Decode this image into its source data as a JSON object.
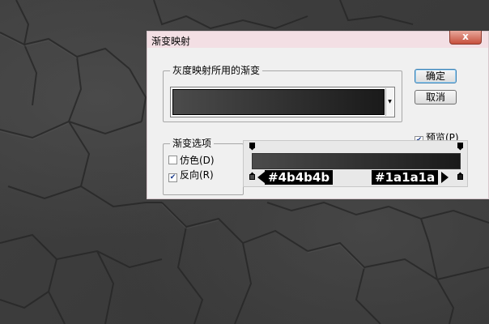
{
  "window": {
    "title": "渐变映射",
    "close_glyph": "x"
  },
  "gradient_group": {
    "label": "灰度映射所用的渐变",
    "dropdown_glyph": "▼"
  },
  "buttons": {
    "ok_label": "确定",
    "cancel_label": "取消"
  },
  "preview": {
    "label": "预览(P)",
    "checked": true
  },
  "options_group": {
    "label": "渐变选项",
    "dither_label": "仿色(D)",
    "dither_checked": false,
    "reverse_label": "反向(R)",
    "reverse_checked": true
  },
  "gradient": {
    "left_color": "#4b4b4b",
    "right_color": "#1a1a1a",
    "left_label": "#4b4b4b",
    "right_label": "#1a1a1a"
  },
  "icons": {
    "close": "close-icon",
    "dropdown": "chevron-down-icon",
    "check": "checkmark-icon",
    "opacity_stop": "opacity-stop-icon",
    "color_stop": "color-stop-icon"
  }
}
